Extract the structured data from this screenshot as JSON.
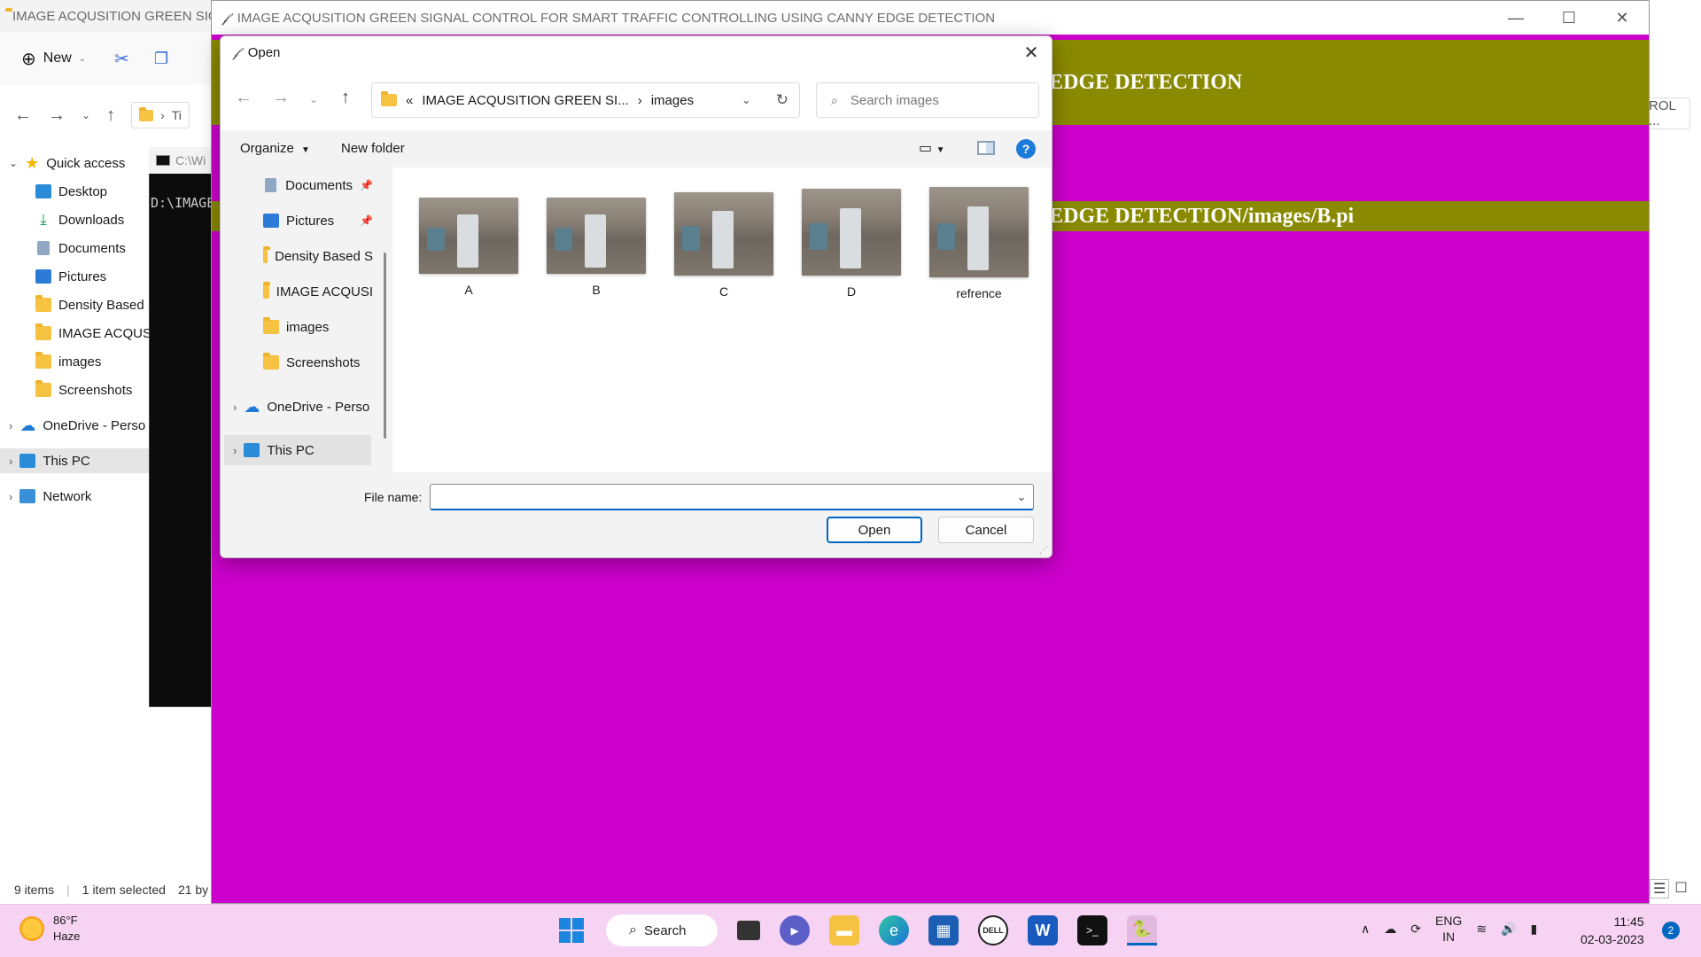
{
  "explorer": {
    "title": "IMAGE ACQUSITION GREEN SIG",
    "new_label": "New",
    "breadcrumb_short": "Ti",
    "address_right": "ROL ...",
    "sidebar": [
      {
        "label": "Quick access",
        "icon": "star-icon"
      },
      {
        "label": "Desktop",
        "icon": "desktop-icon"
      },
      {
        "label": "Downloads",
        "icon": "download-icon"
      },
      {
        "label": "Documents",
        "icon": "documents-icon"
      },
      {
        "label": "Pictures",
        "icon": "pictures-icon"
      },
      {
        "label": "Density Based S",
        "icon": "folder-icon"
      },
      {
        "label": "IMAGE ACQUSIT",
        "icon": "folder-icon"
      },
      {
        "label": "images",
        "icon": "folder-icon"
      },
      {
        "label": "Screenshots",
        "icon": "folder-icon"
      },
      {
        "label": "OneDrive - Perso",
        "icon": "cloud-icon"
      },
      {
        "label": "This PC",
        "icon": "pc-icon"
      },
      {
        "label": "Network",
        "icon": "network-icon"
      }
    ],
    "status_items": "9 items",
    "status_selected": "1 item selected",
    "status_size": "21 by"
  },
  "console": {
    "title": "C:\\Wi",
    "text": "D:\\IMAGE"
  },
  "app": {
    "title": "IMAGE ACQUSITION GREEN SIGNAL CONTROL FOR SMART TRAFFIC CONTROLLING USING CANNY EDGE DETECTION",
    "banner_text": "ONTROLLING USING CANNY EDGE DETECTION",
    "path_text": "ONTROLLING USING CANNY EDGE DETECTION/images/B.pi",
    "colors": {
      "background": "#cc00cc",
      "banner": "#8a8a00"
    }
  },
  "dialog": {
    "title": "Open",
    "address_prefix": "«",
    "address_parent": "IMAGE ACQUSITION GREEN SI...",
    "address_current": "images",
    "search_placeholder": "Search images",
    "organize_label": "Organize",
    "new_folder_label": "New folder",
    "nav_items": [
      {
        "label": "Documents",
        "icon": "documents-icon",
        "pinned": true
      },
      {
        "label": "Pictures",
        "icon": "pictures-icon",
        "pinned": true
      },
      {
        "label": "Density Based S",
        "icon": "folder-icon",
        "pinned": false
      },
      {
        "label": "IMAGE ACQUSI",
        "icon": "folder-icon",
        "pinned": false
      },
      {
        "label": "images",
        "icon": "folder-icon",
        "pinned": false
      },
      {
        "label": "Screenshots",
        "icon": "folder-icon",
        "pinned": false
      },
      {
        "label": "OneDrive - Perso",
        "icon": "cloud-icon",
        "pinned": false
      },
      {
        "label": "This PC",
        "icon": "pc-icon",
        "pinned": false
      }
    ],
    "files": [
      "A",
      "B",
      "C",
      "D",
      "refrence"
    ],
    "file_name_label": "File name:",
    "file_name_value": "",
    "open_label": "Open",
    "cancel_label": "Cancel"
  },
  "taskbar": {
    "temperature": "86°F",
    "weather": "Haze",
    "search_label": "Search",
    "lang_1": "ENG",
    "lang_2": "IN",
    "time": "11:45",
    "date": "02-03-2023",
    "notifications": "2"
  }
}
